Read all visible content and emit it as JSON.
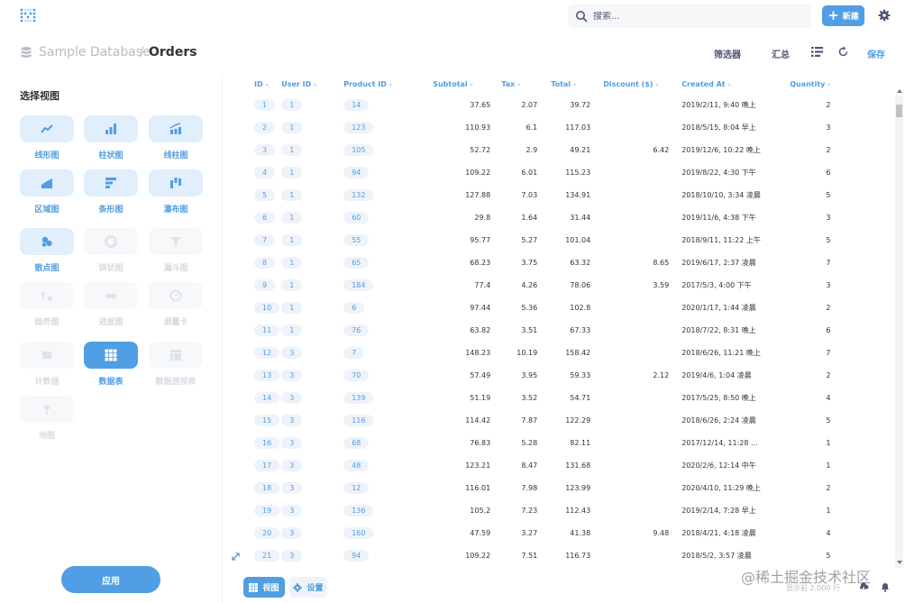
{
  "search": {
    "placeholder": "搜索..."
  },
  "toolbar": {
    "new_label": "新建"
  },
  "breadcrumb": {
    "database": "Sample Database",
    "separator": "/",
    "title": "Orders"
  },
  "header": {
    "filter_label": "筛选器",
    "summarize_label": "汇总",
    "save_label": "保存"
  },
  "sidebar": {
    "title": "选择视图",
    "viz": [
      {
        "label": "线形图",
        "icon": "line-chart-icon",
        "state": "enabled"
      },
      {
        "label": "柱状图",
        "icon": "bar-chart-icon",
        "state": "enabled"
      },
      {
        "label": "线柱图",
        "icon": "combo-chart-icon",
        "state": "enabled"
      },
      {
        "label": "区域图",
        "icon": "area-chart-icon",
        "state": "enabled"
      },
      {
        "label": "条形图",
        "icon": "row-chart-icon",
        "state": "enabled"
      },
      {
        "label": "瀑布图",
        "icon": "waterfall-chart-icon",
        "state": "enabled"
      },
      {
        "label": "散点图",
        "icon": "scatter-chart-icon",
        "state": "enabled"
      },
      {
        "label": "饼状图",
        "icon": "pie-chart-icon",
        "state": "disabled"
      },
      {
        "label": "漏斗图",
        "icon": "funnel-chart-icon",
        "state": "disabled"
      },
      {
        "label": "趋势图",
        "icon": "trend-icon",
        "state": "disabled"
      },
      {
        "label": "进度图",
        "icon": "progress-icon",
        "state": "disabled"
      },
      {
        "label": "测量卡",
        "icon": "gauge-icon",
        "state": "disabled"
      },
      {
        "label": "计数器",
        "icon": "number-icon",
        "state": "disabled"
      },
      {
        "label": "数据表",
        "icon": "table-icon",
        "state": "active"
      },
      {
        "label": "数据透视表",
        "icon": "pivot-table-icon",
        "state": "disabled"
      },
      {
        "label": "地图",
        "icon": "map-pin-icon",
        "state": "disabled"
      }
    ],
    "apply_label": "应用"
  },
  "table": {
    "columns": [
      "ID",
      "User ID",
      "Product ID",
      "Subtotal",
      "Tax",
      "Total",
      "Discount ($)",
      "Created At",
      "Quantity"
    ],
    "rows": [
      [
        "1",
        "1",
        "14",
        "37.65",
        "2.07",
        "39.72",
        "",
        "2019/2/11, 9:40 晚上",
        "2"
      ],
      [
        "2",
        "1",
        "123",
        "110.93",
        "6.1",
        "117.03",
        "",
        "2018/5/15, 8:04 早上",
        "3"
      ],
      [
        "3",
        "1",
        "105",
        "52.72",
        "2.9",
        "49.21",
        "6.42",
        "2019/12/6, 10:22 晚上",
        "2"
      ],
      [
        "4",
        "1",
        "94",
        "109.22",
        "6.01",
        "115.23",
        "",
        "2019/8/22, 4:30 下午",
        "6"
      ],
      [
        "5",
        "1",
        "132",
        "127.88",
        "7.03",
        "134.91",
        "",
        "2018/10/10, 3:34 凌晨",
        "5"
      ],
      [
        "6",
        "1",
        "60",
        "29.8",
        "1.64",
        "31.44",
        "",
        "2019/11/6, 4:38 下午",
        "3"
      ],
      [
        "7",
        "1",
        "55",
        "95.77",
        "5.27",
        "101.04",
        "",
        "2018/9/11, 11:22 上午",
        "5"
      ],
      [
        "8",
        "1",
        "65",
        "68.23",
        "3.75",
        "63.32",
        "8.65",
        "2019/6/17, 2:37 凌晨",
        "7"
      ],
      [
        "9",
        "1",
        "184",
        "77.4",
        "4.26",
        "78.06",
        "3.59",
        "2017/5/3, 4:00 下午",
        "3"
      ],
      [
        "10",
        "1",
        "6",
        "97.44",
        "5.36",
        "102.8",
        "",
        "2020/1/17, 1:44 凌晨",
        "2"
      ],
      [
        "11",
        "1",
        "76",
        "63.82",
        "3.51",
        "67.33",
        "",
        "2018/7/22, 8:31 晚上",
        "6"
      ],
      [
        "12",
        "3",
        "7",
        "148.23",
        "10.19",
        "158.42",
        "",
        "2018/6/26, 11:21 晚上",
        "7"
      ],
      [
        "13",
        "3",
        "70",
        "57.49",
        "3.95",
        "59.33",
        "2.12",
        "2019/4/6, 1:04 凌晨",
        "2"
      ],
      [
        "14",
        "3",
        "139",
        "51.19",
        "3.52",
        "54.71",
        "",
        "2017/5/25, 8:50 晚上",
        "4"
      ],
      [
        "15",
        "3",
        "116",
        "114.42",
        "7.87",
        "122.29",
        "",
        "2018/6/26, 2:24 凌晨",
        "5"
      ],
      [
        "16",
        "3",
        "68",
        "76.83",
        "5.28",
        "82.11",
        "",
        "2017/12/14, 11:28 ...",
        "1"
      ],
      [
        "17",
        "3",
        "48",
        "123.21",
        "8.47",
        "131.68",
        "",
        "2020/2/6, 12:14 中午",
        "1"
      ],
      [
        "18",
        "3",
        "12",
        "116.01",
        "7.98",
        "123.99",
        "",
        "2020/4/10, 11:29 晚上",
        "2"
      ],
      [
        "19",
        "3",
        "136",
        "105.2",
        "7.23",
        "112.43",
        "",
        "2019/2/14, 7:28 早上",
        "1"
      ],
      [
        "20",
        "3",
        "160",
        "47.59",
        "3.27",
        "41.38",
        "9.48",
        "2018/4/21, 4:18 凌晨",
        "4"
      ],
      [
        "21",
        "3",
        "94",
        "109.22",
        "7.51",
        "116.73",
        "",
        "2018/5/2, 3:57 凌晨",
        "5"
      ]
    ]
  },
  "footer": {
    "view_label": "视图",
    "settings_label": "设置",
    "row_count": "显示前 2,000 行"
  },
  "watermark": "@稀土掘金技术社区",
  "colors": {
    "brand": "#509ee3",
    "text": "#4c5773",
    "muted": "#b8bbc3"
  }
}
